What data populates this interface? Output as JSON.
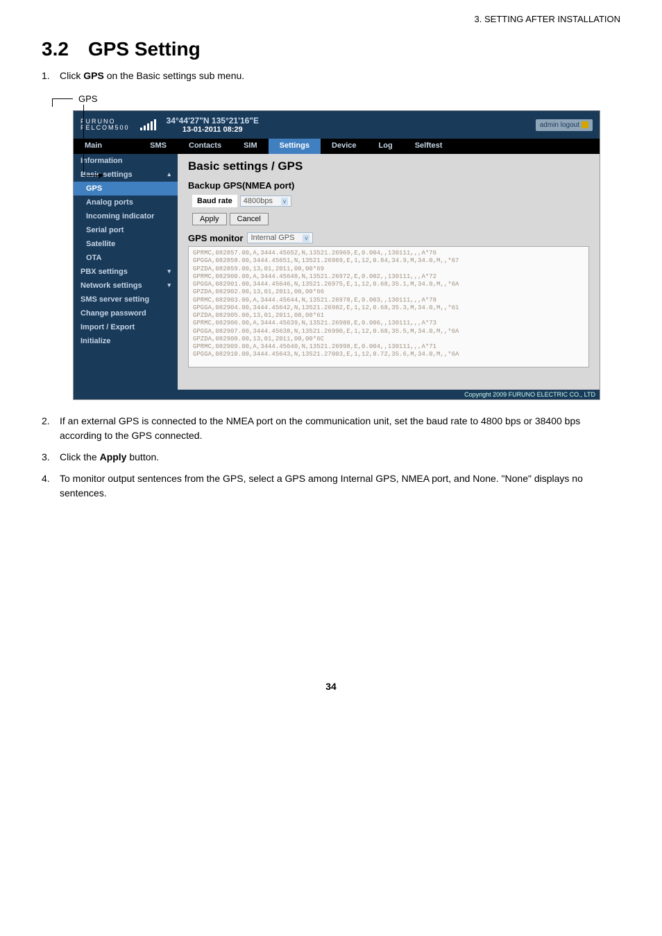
{
  "header_context": "3.  SETTING AFTER INSTALLATION",
  "section": {
    "num": "3.2",
    "title": "GPS Setting"
  },
  "steps": [
    {
      "num": "1.",
      "pre": "Click ",
      "bold": "GPS",
      "post": " on the Basic settings sub menu."
    },
    {
      "num": "2.",
      "text": "If an external GPS is connected to the NMEA port on the communication unit, set the baud rate to 4800 bps or 38400 bps according to the GPS connected."
    },
    {
      "num": "3.",
      "pre": "Click the ",
      "bold": "Apply",
      "post": " button."
    },
    {
      "num": "4.",
      "text": "To monitor output sentences from the GPS, select a GPS among Internal GPS, NMEA port, and None. \"None\" displays no sentences."
    }
  ],
  "gps_callout": "GPS",
  "app": {
    "brand": "FURUNO",
    "model": "FELCOM500",
    "coords": "34°44'27\"N   135°21'16\"E",
    "datetime": "13-01-2011 08:29",
    "logout_label": "admin logout",
    "menubar": {
      "main": "Main",
      "sms": "SMS",
      "contacts": "Contacts",
      "sim": "SIM",
      "settings": "Settings",
      "device": "Device",
      "log": "Log",
      "selftest": "Selftest"
    },
    "sidebar": [
      {
        "label": "Information"
      },
      {
        "label": "Basic settings",
        "caret": "up"
      },
      {
        "label": "GPS",
        "active": true,
        "indent": true
      },
      {
        "label": "Analog ports",
        "indent": true
      },
      {
        "label": "Incoming indicator",
        "indent": true
      },
      {
        "label": "Serial port",
        "indent": true
      },
      {
        "label": "Satellite",
        "indent": true
      },
      {
        "label": "OTA",
        "indent": true
      },
      {
        "label": "PBX settings",
        "caret": "down"
      },
      {
        "label": "Network settings",
        "caret": "down"
      },
      {
        "label": "SMS server setting"
      },
      {
        "label": "Change password"
      },
      {
        "label": "Import / Export"
      },
      {
        "label": "Initialize"
      }
    ],
    "content": {
      "title": "Basic settings / GPS",
      "backup_heading": "Backup GPS(NMEA port)",
      "baud_label": "Baud rate",
      "baud_value": "4800bps",
      "apply": "Apply",
      "cancel": "Cancel",
      "monitor_label": "GPS monitor",
      "monitor_value": "Internal GPS",
      "console": "GPRMC,082857.00,A,3444.45652,N,13521.26969,E,0.004,,130111,,,A*76\nGPGGA,082858.00,3444.45651,N,13521.26969,E,1,12,0.84,34.9,M,34.0,M,,*67\nGPZDA,082859.00,13,01,2011,00,00*69\nGPRMC,082900.00,A,3444.45648,N,13521.26972,E,0.002,,130111,,,A*72\nGPGGA,082901.00,3444.45646,N,13521.26975,E,1,12,0.68,35.1,M,34.0,M,,*6A\nGPZDA,082902.00,13,01,2011,00,00*66\nGPRMC,082903.00,A,3444.45644,N,13521.26978,E,0.003,,130111,,,A*78\nGPGGA,082904.00,3444.45642,N,13521.26982,E,1,12,0.68,35.3,M,34.0,M,,*61\nGPZDA,082905.00,13,01,2011,00,00*61\nGPRMC,082906.00,A,3444.45639,N,13521.26988,E,0.006,,130111,,,A*73\nGPGGA,082907.00,3444.45638,N,13521.26990,E,1,12,0.68,35.5,M,34.0,M,,*6A\nGPZDA,082908.00,13,01,2011,00,00*6C\nGPRMC,082909.00,A,3444.45640,N,13521.26998,E,0.004,,130111,,,A*71\nGPGGA,082910.00,3444.45643,N,13521.27003,E,1,12,0.72,35.6,M,34.0,M,,*6A"
    },
    "copyright": "Copyright 2009 FURUNO ELECTRIC CO., LTD"
  },
  "page_number": "34"
}
